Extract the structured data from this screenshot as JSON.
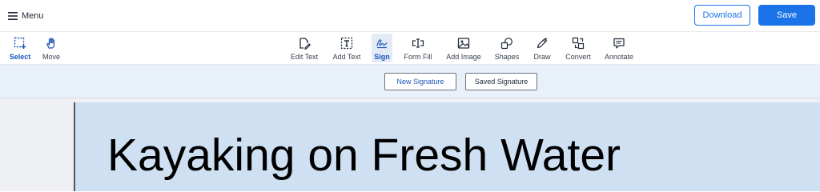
{
  "header": {
    "menu_label": "Menu",
    "download_label": "Download",
    "save_label": "Save",
    "accent_color": "#1a73e8"
  },
  "toolbar": {
    "active_tool": "Sign",
    "tools": [
      {
        "id": "select",
        "label": "Select",
        "icon": "select-marquee-icon"
      },
      {
        "id": "move",
        "label": "Move",
        "icon": "hand-icon"
      },
      {
        "id": "edit-text",
        "label": "Edit Text",
        "icon": "edit-text-icon"
      },
      {
        "id": "add-text",
        "label": "Add Text",
        "icon": "add-text-icon"
      },
      {
        "id": "sign",
        "label": "Sign",
        "icon": "signature-icon"
      },
      {
        "id": "form-fill",
        "label": "Form Fill",
        "icon": "form-fill-icon"
      },
      {
        "id": "add-image",
        "label": "Add Image",
        "icon": "image-icon"
      },
      {
        "id": "shapes",
        "label": "Shapes",
        "icon": "shapes-icon"
      },
      {
        "id": "draw",
        "label": "Draw",
        "icon": "pencil-icon"
      },
      {
        "id": "convert",
        "label": "Convert",
        "icon": "convert-icon"
      },
      {
        "id": "annotate",
        "label": "Annotate",
        "icon": "comment-icon"
      }
    ]
  },
  "signature_bar": {
    "new_label": "New Signature",
    "saved_label": "Saved Signature"
  },
  "document": {
    "title": "Kayaking on Fresh Water"
  }
}
